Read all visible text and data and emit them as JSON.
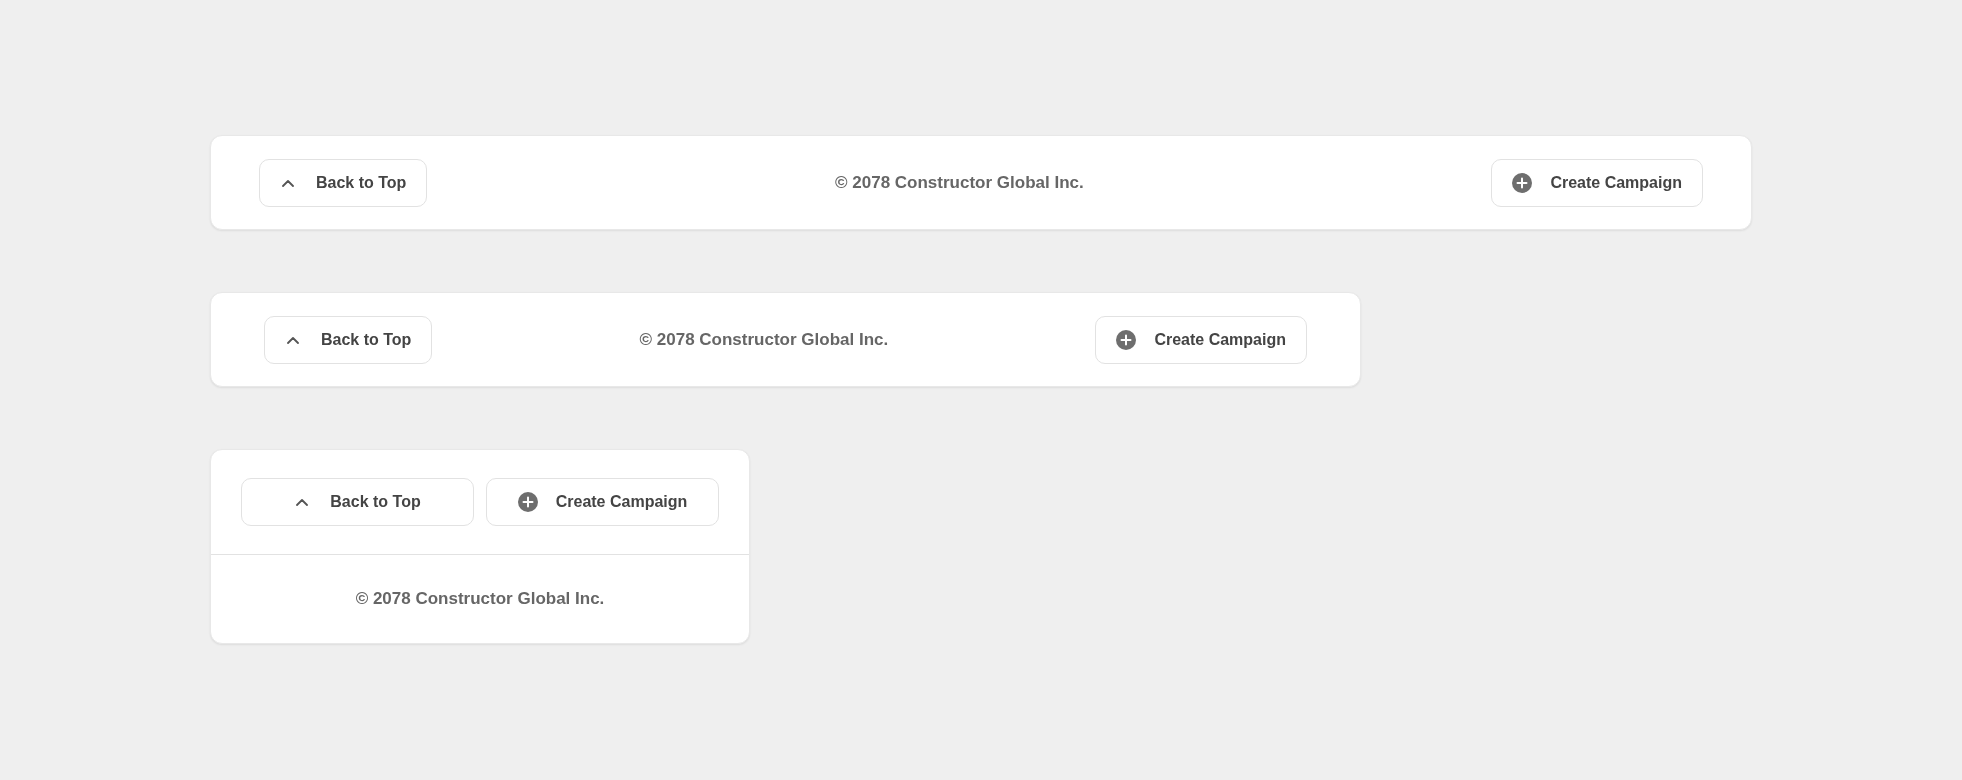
{
  "footers": [
    {
      "kind": "wide",
      "back_button": "Back to Top",
      "copyright": "© 2078 Constructor Global Inc.",
      "create_button": "Create Campaign"
    },
    {
      "kind": "medium",
      "back_button": "Back to Top",
      "copyright": "© 2078 Constructor Global Inc.",
      "create_button": "Create Campaign"
    },
    {
      "kind": "stacked",
      "back_button": "Back to Top",
      "copyright": "© 2078 Constructor Global Inc.",
      "create_button": "Create Campaign"
    }
  ]
}
